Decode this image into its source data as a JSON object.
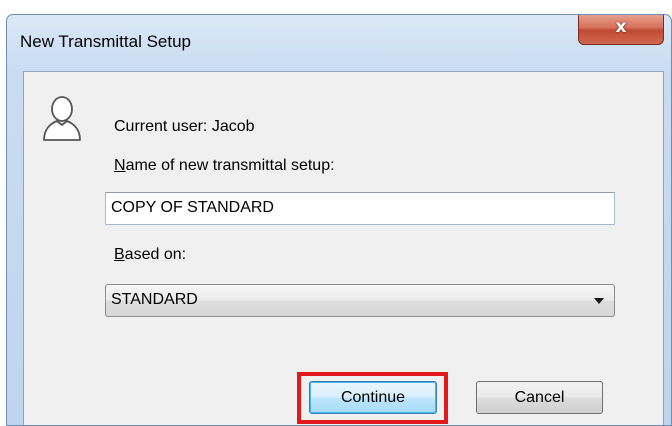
{
  "window": {
    "title": "New Transmittal Setup",
    "close_glyph": "x"
  },
  "form": {
    "current_user": "Current user: Jacob",
    "name_label_key": "N",
    "name_label_rest": "ame of new transmittal setup:",
    "name_value": "COPY OF STANDARD",
    "based_on_key": "B",
    "based_on_rest": "ased on:",
    "based_on_value": "STANDARD"
  },
  "buttons": {
    "continue": "Continue",
    "cancel": "Cancel"
  },
  "icons": {
    "user": "user-silhouette-icon",
    "dropdown": "chevron-down-icon",
    "close": "close-icon"
  },
  "colors": {
    "highlight": "#e2191b",
    "close_button": "#c04a33",
    "default_button_border": "#3c7fb1"
  }
}
